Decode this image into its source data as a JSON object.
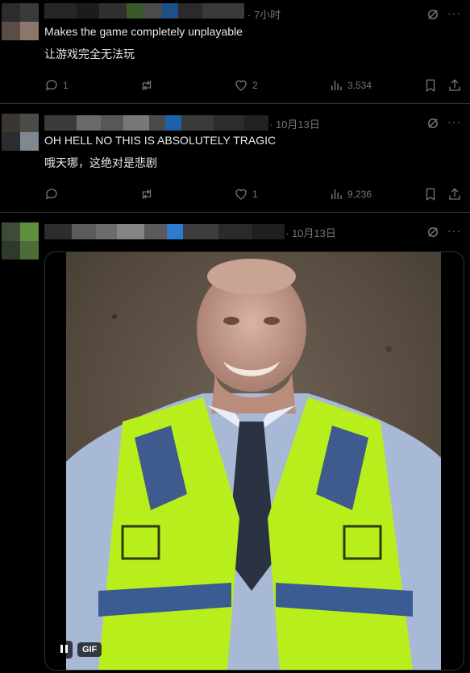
{
  "posts": [
    {
      "time": "· 7小时",
      "text_en": "Makes the game completely unplayable",
      "text_zh": "让游戏完全无法玩",
      "replies": "1",
      "reposts": "",
      "likes": "2",
      "views": "3,534"
    },
    {
      "time": "· 10月13日",
      "text_en": "OH HELL NO THIS IS ABSOLUTELY TRAGIC",
      "text_zh": "哦天哪，这绝对是悲剧",
      "replies": "",
      "reposts": "",
      "likes": "1",
      "views": "9,236"
    },
    {
      "time": "· 10月13日",
      "media": {
        "badge": "GIF"
      }
    }
  ],
  "icons": {
    "reply": "reply-icon",
    "repost": "repost-icon",
    "like": "heart-icon",
    "views": "views-icon",
    "bookmark": "bookmark-icon",
    "share": "share-icon",
    "grok": "grok-icon",
    "more": "more-icon",
    "pause": "pause-icon"
  },
  "colors": {
    "background": "#000000",
    "text": "#e7e9ea",
    "muted": "#71767b",
    "divider": "#2f3336"
  }
}
